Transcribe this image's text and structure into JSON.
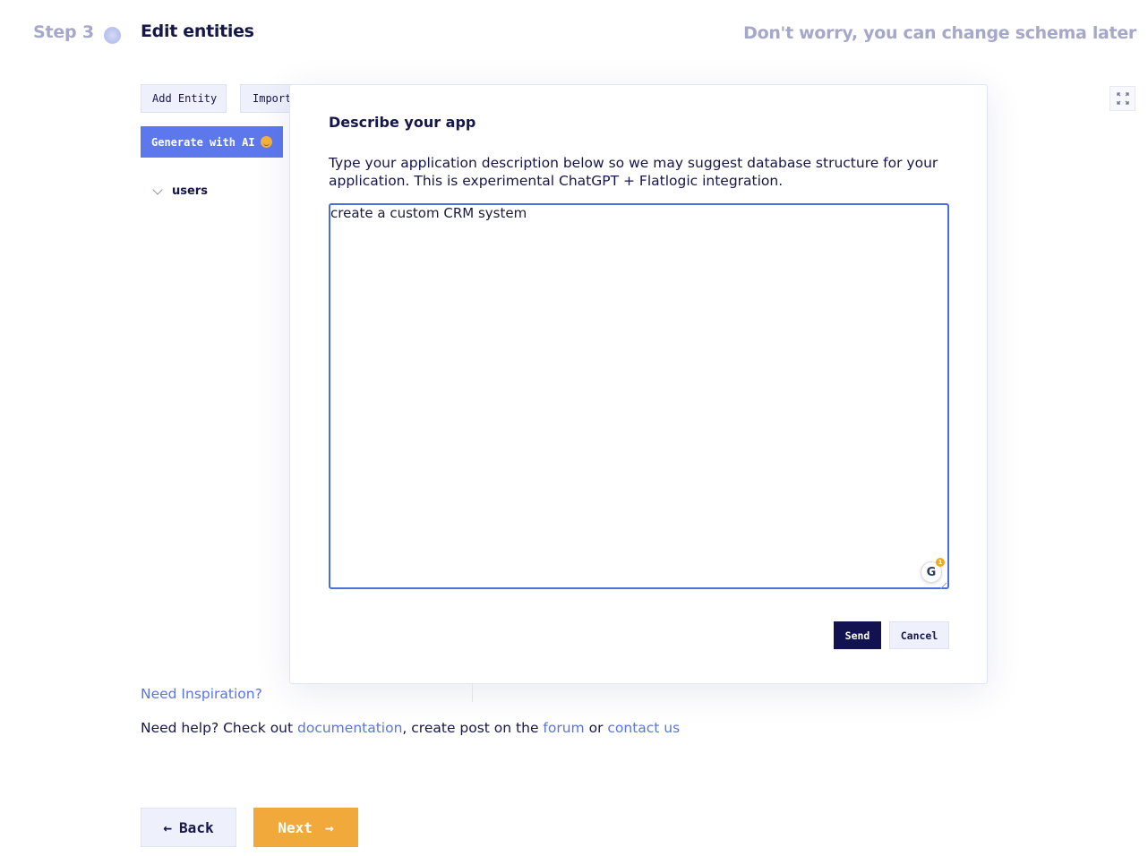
{
  "header": {
    "step_label": "Step 3",
    "title": "Edit entities",
    "hint": "Don't worry, you can change schema later"
  },
  "toolbar": {
    "add_entity_label": "Add Entity",
    "import_label": "Import",
    "generate_label": "Generate with AI"
  },
  "entities": [
    {
      "name": "users"
    }
  ],
  "modal": {
    "title": "Describe your app",
    "description": "Type your application description below so we may suggest database structure for your application. This is experimental ChatGPT + Flatlogic integration.",
    "textarea_value": "create a custom CRM system",
    "send_label": "Send",
    "cancel_label": "Cancel",
    "grammarly_badge": "1"
  },
  "footer": {
    "inspiration_link": "Need Inspiration?",
    "help_prefix": "Need help? Check out ",
    "documentation_link": "documentation",
    "help_middle": ", create post on the ",
    "forum_link": "forum",
    "help_or": " or ",
    "contact_link": "contact us"
  },
  "nav": {
    "back_label": "Back",
    "next_label": "Next"
  },
  "colors": {
    "accent_blue": "#5d78ec",
    "primary_dark": "#11124f",
    "next_orange": "#f2a93b",
    "link_blue": "#5a74e3"
  }
}
